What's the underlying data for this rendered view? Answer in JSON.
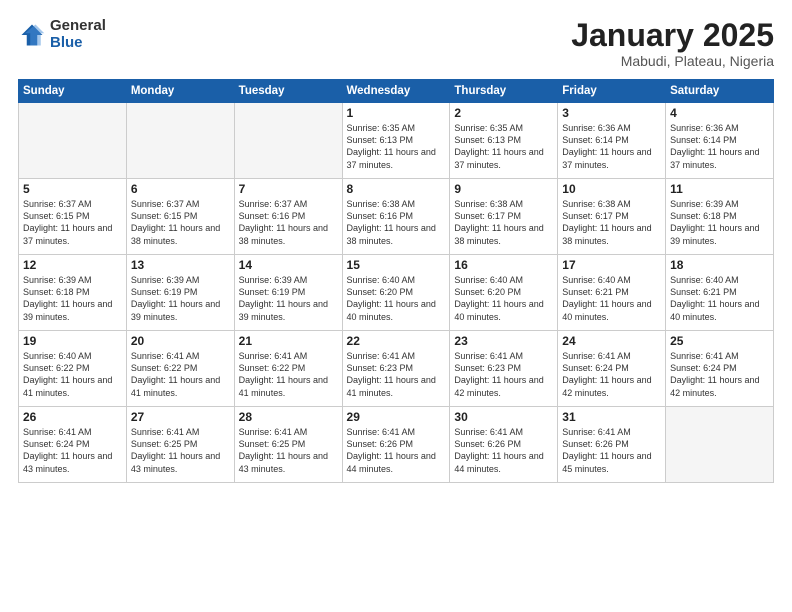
{
  "header": {
    "logo_general": "General",
    "logo_blue": "Blue",
    "title": "January 2025",
    "subtitle": "Mabudi, Plateau, Nigeria"
  },
  "weekdays": [
    "Sunday",
    "Monday",
    "Tuesday",
    "Wednesday",
    "Thursday",
    "Friday",
    "Saturday"
  ],
  "rows": [
    [
      {
        "num": "",
        "info": ""
      },
      {
        "num": "",
        "info": ""
      },
      {
        "num": "",
        "info": ""
      },
      {
        "num": "1",
        "info": "Sunrise: 6:35 AM\nSunset: 6:13 PM\nDaylight: 11 hours\nand 37 minutes."
      },
      {
        "num": "2",
        "info": "Sunrise: 6:35 AM\nSunset: 6:13 PM\nDaylight: 11 hours\nand 37 minutes."
      },
      {
        "num": "3",
        "info": "Sunrise: 6:36 AM\nSunset: 6:14 PM\nDaylight: 11 hours\nand 37 minutes."
      },
      {
        "num": "4",
        "info": "Sunrise: 6:36 AM\nSunset: 6:14 PM\nDaylight: 11 hours\nand 37 minutes."
      }
    ],
    [
      {
        "num": "5",
        "info": "Sunrise: 6:37 AM\nSunset: 6:15 PM\nDaylight: 11 hours\nand 37 minutes."
      },
      {
        "num": "6",
        "info": "Sunrise: 6:37 AM\nSunset: 6:15 PM\nDaylight: 11 hours\nand 38 minutes."
      },
      {
        "num": "7",
        "info": "Sunrise: 6:37 AM\nSunset: 6:16 PM\nDaylight: 11 hours\nand 38 minutes."
      },
      {
        "num": "8",
        "info": "Sunrise: 6:38 AM\nSunset: 6:16 PM\nDaylight: 11 hours\nand 38 minutes."
      },
      {
        "num": "9",
        "info": "Sunrise: 6:38 AM\nSunset: 6:17 PM\nDaylight: 11 hours\nand 38 minutes."
      },
      {
        "num": "10",
        "info": "Sunrise: 6:38 AM\nSunset: 6:17 PM\nDaylight: 11 hours\nand 38 minutes."
      },
      {
        "num": "11",
        "info": "Sunrise: 6:39 AM\nSunset: 6:18 PM\nDaylight: 11 hours\nand 39 minutes."
      }
    ],
    [
      {
        "num": "12",
        "info": "Sunrise: 6:39 AM\nSunset: 6:18 PM\nDaylight: 11 hours\nand 39 minutes."
      },
      {
        "num": "13",
        "info": "Sunrise: 6:39 AM\nSunset: 6:19 PM\nDaylight: 11 hours\nand 39 minutes."
      },
      {
        "num": "14",
        "info": "Sunrise: 6:39 AM\nSunset: 6:19 PM\nDaylight: 11 hours\nand 39 minutes."
      },
      {
        "num": "15",
        "info": "Sunrise: 6:40 AM\nSunset: 6:20 PM\nDaylight: 11 hours\nand 40 minutes."
      },
      {
        "num": "16",
        "info": "Sunrise: 6:40 AM\nSunset: 6:20 PM\nDaylight: 11 hours\nand 40 minutes."
      },
      {
        "num": "17",
        "info": "Sunrise: 6:40 AM\nSunset: 6:21 PM\nDaylight: 11 hours\nand 40 minutes."
      },
      {
        "num": "18",
        "info": "Sunrise: 6:40 AM\nSunset: 6:21 PM\nDaylight: 11 hours\nand 40 minutes."
      }
    ],
    [
      {
        "num": "19",
        "info": "Sunrise: 6:40 AM\nSunset: 6:22 PM\nDaylight: 11 hours\nand 41 minutes."
      },
      {
        "num": "20",
        "info": "Sunrise: 6:41 AM\nSunset: 6:22 PM\nDaylight: 11 hours\nand 41 minutes."
      },
      {
        "num": "21",
        "info": "Sunrise: 6:41 AM\nSunset: 6:22 PM\nDaylight: 11 hours\nand 41 minutes."
      },
      {
        "num": "22",
        "info": "Sunrise: 6:41 AM\nSunset: 6:23 PM\nDaylight: 11 hours\nand 41 minutes."
      },
      {
        "num": "23",
        "info": "Sunrise: 6:41 AM\nSunset: 6:23 PM\nDaylight: 11 hours\nand 42 minutes."
      },
      {
        "num": "24",
        "info": "Sunrise: 6:41 AM\nSunset: 6:24 PM\nDaylight: 11 hours\nand 42 minutes."
      },
      {
        "num": "25",
        "info": "Sunrise: 6:41 AM\nSunset: 6:24 PM\nDaylight: 11 hours\nand 42 minutes."
      }
    ],
    [
      {
        "num": "26",
        "info": "Sunrise: 6:41 AM\nSunset: 6:24 PM\nDaylight: 11 hours\nand 43 minutes."
      },
      {
        "num": "27",
        "info": "Sunrise: 6:41 AM\nSunset: 6:25 PM\nDaylight: 11 hours\nand 43 minutes."
      },
      {
        "num": "28",
        "info": "Sunrise: 6:41 AM\nSunset: 6:25 PM\nDaylight: 11 hours\nand 43 minutes."
      },
      {
        "num": "29",
        "info": "Sunrise: 6:41 AM\nSunset: 6:26 PM\nDaylight: 11 hours\nand 44 minutes."
      },
      {
        "num": "30",
        "info": "Sunrise: 6:41 AM\nSunset: 6:26 PM\nDaylight: 11 hours\nand 44 minutes."
      },
      {
        "num": "31",
        "info": "Sunrise: 6:41 AM\nSunset: 6:26 PM\nDaylight: 11 hours\nand 45 minutes."
      },
      {
        "num": "",
        "info": ""
      }
    ]
  ]
}
